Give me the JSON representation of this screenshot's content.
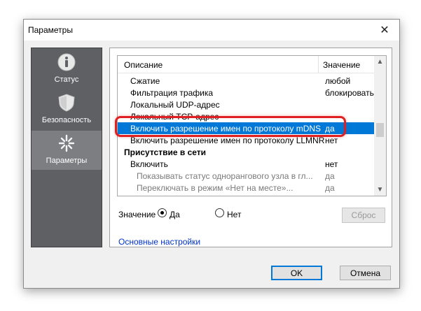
{
  "window": {
    "title": "Параметры"
  },
  "sidebar": {
    "items": [
      {
        "label": "Статус",
        "icon": "info-icon"
      },
      {
        "label": "Безопасность",
        "icon": "shield-icon"
      },
      {
        "label": "Параметры",
        "icon": "settings-sparkle-icon",
        "selected": true
      }
    ]
  },
  "list": {
    "headers": {
      "description": "Описание",
      "value": "Значение"
    },
    "rows": [
      {
        "label": "Сжатие",
        "value": "любой"
      },
      {
        "label": "Фильтрация трафика",
        "value": "блокировать"
      },
      {
        "label": "Локальный UDP-адрес",
        "value": ""
      },
      {
        "label": "Локальный TCP-адрес",
        "value": ""
      },
      {
        "label": "Включить разрешение имен по протоколу mDNS",
        "value": "да",
        "selected": true
      },
      {
        "label": "Включить разрешение имен по протоколу LLMNR",
        "value": "нет"
      },
      {
        "label": "Присутствие в сети",
        "value": "",
        "group": true
      },
      {
        "label": "Включить",
        "value": "нет"
      },
      {
        "label": "Показывать статус однорангового узла в гл...",
        "value": "да",
        "disabled": true
      },
      {
        "label": "Переключать в режим «Нет на месте»...",
        "value": "да",
        "disabled": true
      }
    ]
  },
  "value_selector": {
    "label": "Значение",
    "options": [
      "Да",
      "Нет"
    ],
    "selected": "Да",
    "reset_label": "Сброс"
  },
  "basic_settings_link": "Основные настройки",
  "buttons": {
    "ok": "OK",
    "cancel": "Отмена"
  },
  "colors": {
    "selection": "#0078d7",
    "highlight": "#e02020",
    "sidebar": "#5f6064",
    "link": "#0033cc"
  }
}
